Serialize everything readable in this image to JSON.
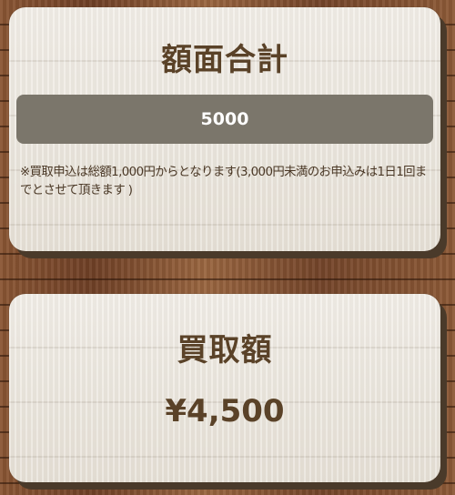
{
  "total_card": {
    "title": "額面合計",
    "value": "5000",
    "note": "※買取申込は総額1,000円からとなります(3,000円未満のお申込みは1日1回までとさせて頂きます )"
  },
  "purchase_card": {
    "title": "買取額",
    "amount": "¥4,500"
  },
  "colors": {
    "title_text": "#5a4228",
    "display_bg": "#7b766b",
    "display_text": "#ffffff",
    "card_bg": "#ece7de"
  }
}
